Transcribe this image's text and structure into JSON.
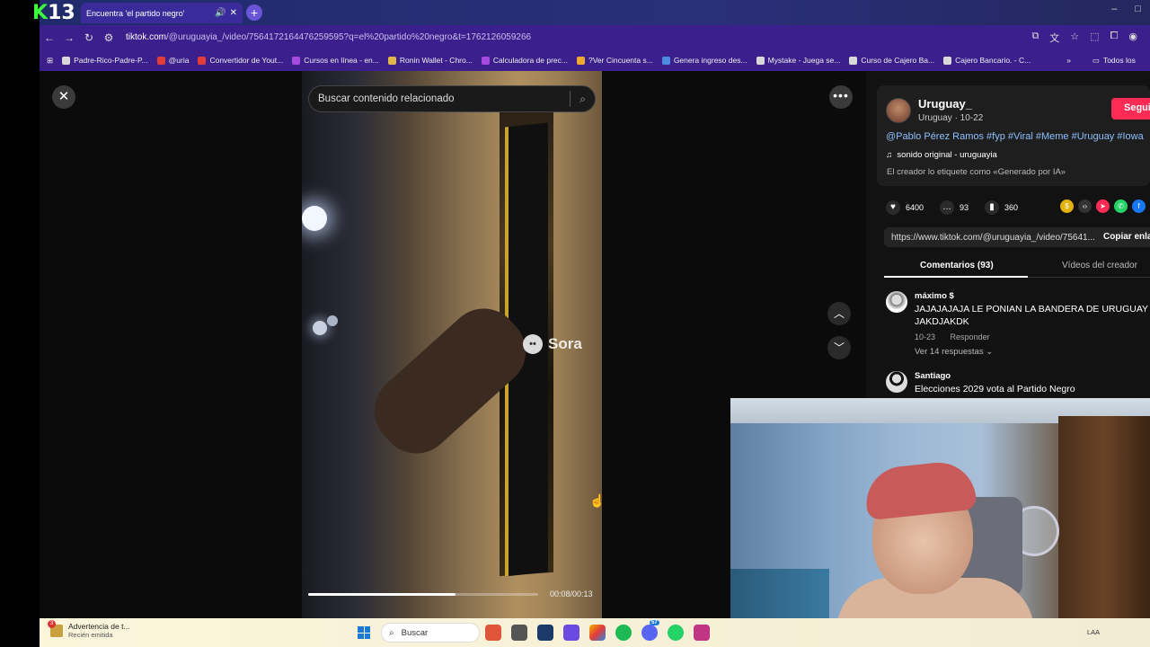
{
  "stream_logo": {
    "k": "K",
    "n": "13"
  },
  "browser": {
    "tab_title": "Encuentra 'el partido negro'",
    "url_host": "tiktok.com",
    "url_path": "/@uruguayia_/video/7564172164476259595?q=el%20partido%20negro&t=1762126059266",
    "window_controls": [
      "–",
      "□"
    ],
    "bookmarks": [
      {
        "label": "Padre-Rico-Padre-P...",
        "color": "#d9d9d9"
      },
      {
        "label": "@uria",
        "color": "#e23b3b"
      },
      {
        "label": "Convertidor de Yout...",
        "color": "#e23b3b"
      },
      {
        "label": "Cursos en línea - en...",
        "color": "#a64be0"
      },
      {
        "label": "Ronin Wallet - Chro...",
        "color": "#e0b74b"
      },
      {
        "label": "Calculadora de prec...",
        "color": "#a64be0"
      },
      {
        "label": "?Ver Cincuenta s...",
        "color": "#f0a830"
      },
      {
        "label": "Genera ingreso des...",
        "color": "#4b8be0"
      },
      {
        "label": "Mystake - Juega se...",
        "color": "#d9d9d9"
      },
      {
        "label": "Curso de Cajero Ba...",
        "color": "#d9d9d9"
      },
      {
        "label": "Cajero Bancario. - C...",
        "color": "#d9d9d9"
      }
    ],
    "all_bookmarks": "Todos los"
  },
  "tiktok": {
    "search_placeholder": "Buscar contenido relacionado",
    "watermark": "Sora",
    "progress_fraction": 0.64,
    "timecode": "00:08/00:13",
    "author": {
      "name": "Uruguay_",
      "sub": "Uruguay · 10-22",
      "follow_label": "Segui",
      "caption": "@Pablo Pérez Ramos #fyp #Viral #Meme #Uruguay #Iowa",
      "sound": "sonido original - uruguayia",
      "ai_label": "El creador lo etiquete como «Generado por IA»"
    },
    "stats": {
      "likes": "6400",
      "comments": "93",
      "saves": "360"
    },
    "link": {
      "url": "https://www.tiktok.com/@uruguayia_/video/75641...",
      "copy_label": "Copiar enla"
    },
    "tabs": {
      "comments": "Comentarios (93)",
      "videos": "Vídeos del creador"
    },
    "comments": [
      {
        "user": "máximo $",
        "text": "JAJAJAJAJA LE PONIAN LA BANDERA DE URUGUAY JAKDJAKDK",
        "date": "10-23",
        "reply": "Responder",
        "replies": "Ver 14 respuestas ⌄"
      },
      {
        "user": "Santiago",
        "text": "Elecciones 2029 vota al Partido Negro"
      }
    ]
  },
  "taskbar": {
    "notif_title": "Advertencia de t...",
    "notif_sub": "Recién emitida",
    "notif_badge": "3",
    "search_label": "Buscar",
    "app_badge": "57",
    "tray_text": "LAA"
  }
}
